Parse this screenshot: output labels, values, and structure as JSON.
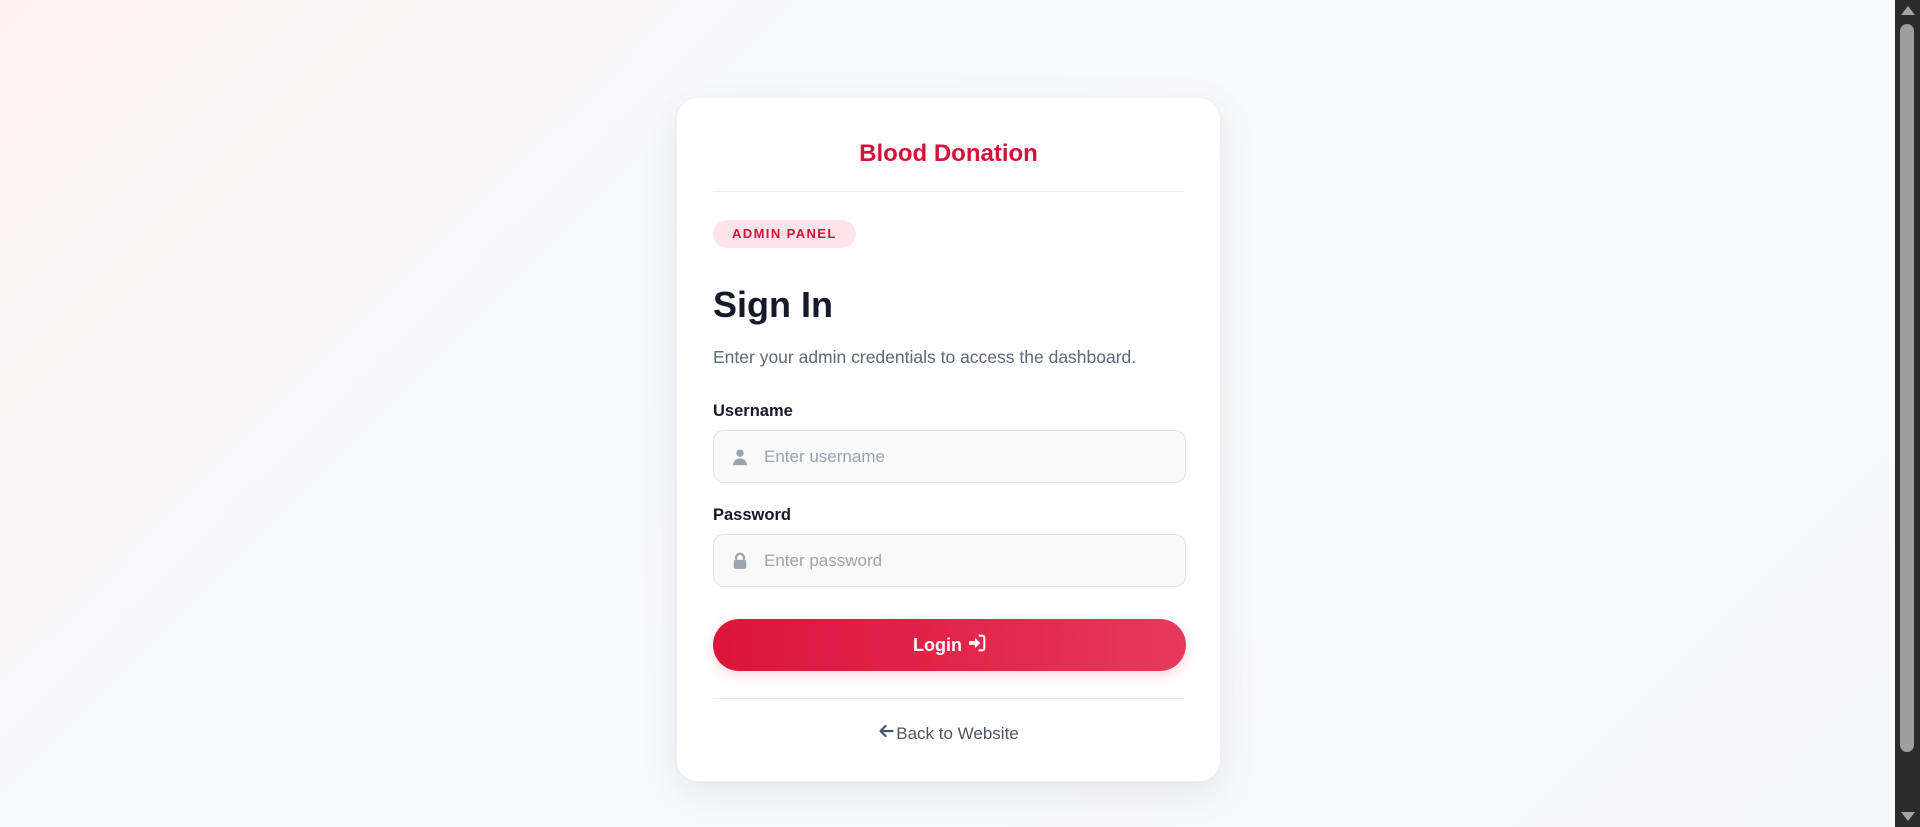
{
  "brand": {
    "title": "Blood Donation",
    "color": "#d1143c"
  },
  "badge": {
    "label": "ADMIN PANEL"
  },
  "form": {
    "title": "Sign In",
    "subtitle": "Enter your admin credentials to access the dashboard.",
    "username": {
      "label": "Username",
      "placeholder": "Enter username",
      "value": "",
      "icon": "user-icon"
    },
    "password": {
      "label": "Password",
      "placeholder": "Enter password",
      "value": "",
      "icon": "lock-icon"
    },
    "submit": {
      "label": "Login",
      "icon": "sign-in-icon"
    }
  },
  "footer": {
    "back_label": "Back to Website",
    "icon": "arrow-left-icon"
  },
  "colors": {
    "accent": "#dc143c",
    "badge_bg": "#fde4ea",
    "text_dark": "#16182b",
    "text_muted": "#5f6878"
  }
}
